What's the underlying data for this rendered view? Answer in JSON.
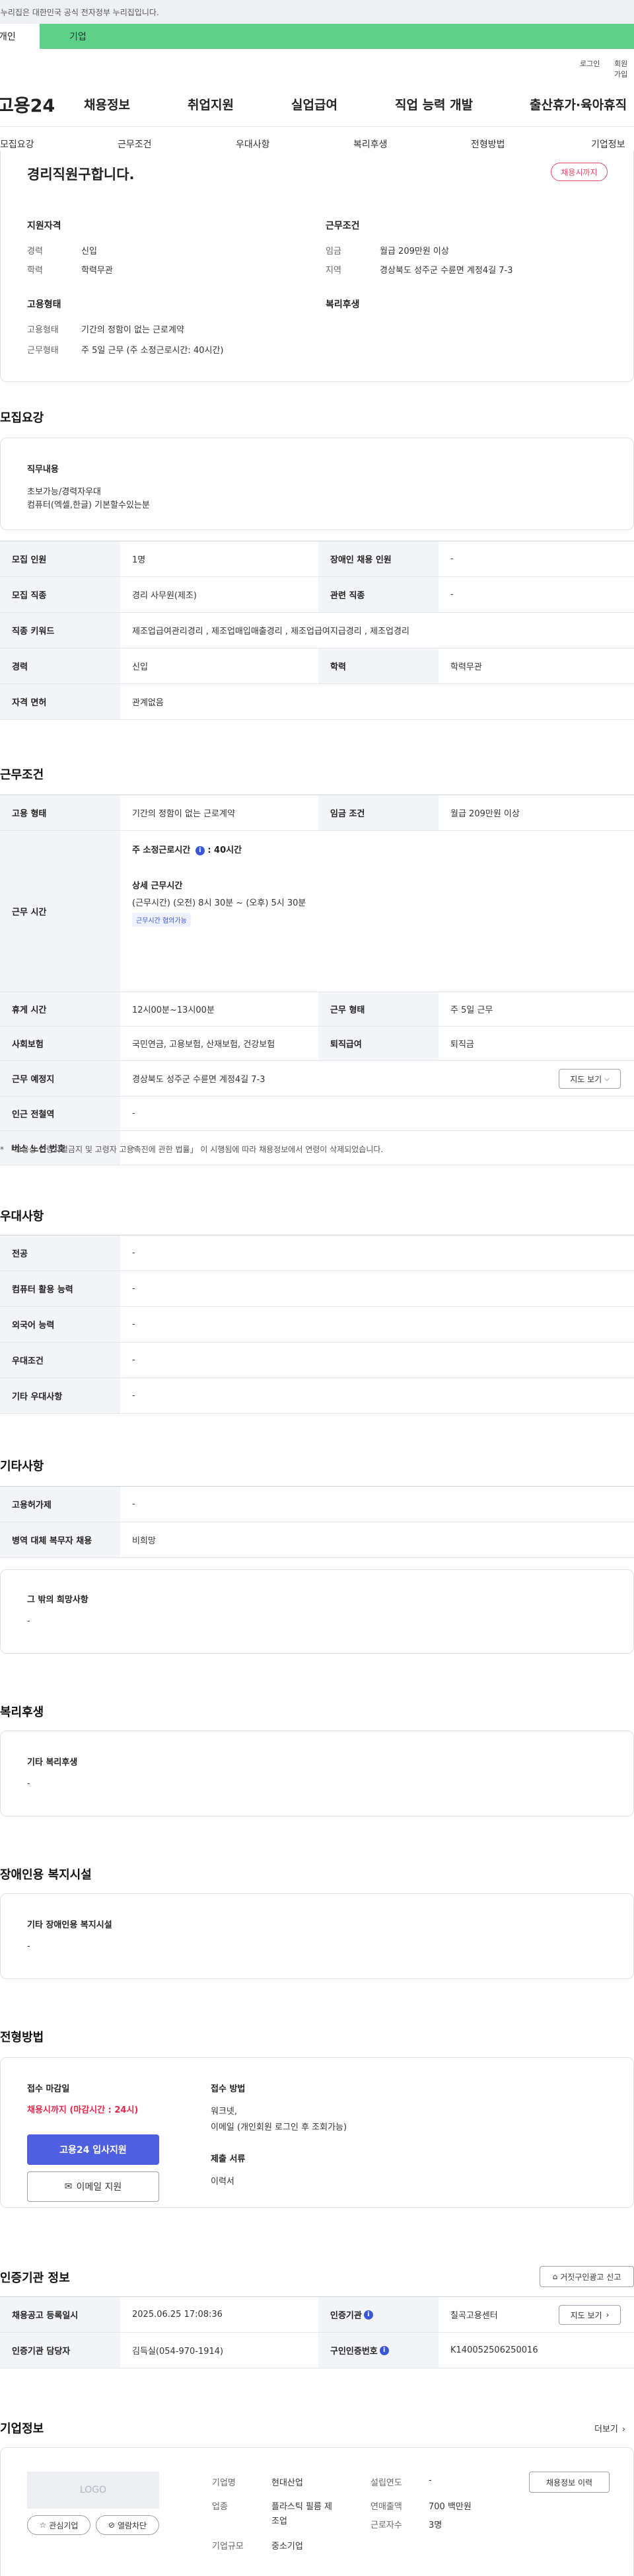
{
  "gov_banner": {
    "text": "이 누리집은 대한민국 공식 전자정부 누리집입니다."
  },
  "user_tabs": {
    "individual": "개인",
    "corporate": "기업"
  },
  "util_links": {
    "login": "로그인",
    "signup": "회원가입"
  },
  "gnb": {
    "logo": "고용24",
    "items": [
      "채용정보",
      "취업지원",
      "실업급여",
      "직업 능력 개발",
      "출산휴가·육아휴직"
    ]
  },
  "subnav": [
    "모집요강",
    "근무조건",
    "우대사항",
    "복리후생",
    "전형방법",
    "기업정보"
  ],
  "summary": {
    "title": "경리직원구합니다.",
    "deadline_badge": "채용시까지",
    "applicant_qual": {
      "heading": "지원자격",
      "career_label": "경력",
      "career": "신입",
      "edu_label": "학력",
      "edu": "학력무관"
    },
    "work_cond": {
      "heading": "근무조건",
      "wage_label": "임금",
      "wage": "월급 209만원 이상",
      "region_label": "지역",
      "region": "경상북도 성주군 수륜면 계정4길 7-3"
    },
    "employment": {
      "heading": "고용형태",
      "type_label": "고용형태",
      "type": "기간의 정함이 없는 근로계약",
      "hours_label": "근무형태",
      "hours": "주 5일 근무 (주 소정근로시간: 40시간)"
    },
    "welfare_heading": "복리후생"
  },
  "recruit": {
    "title": "모집요강",
    "duty_heading": "직무내용",
    "duty_lines": [
      "초보가능/경력자우대",
      "컴퓨터(엑셀,한글) 기본할수있는분"
    ],
    "rows": [
      {
        "h1": "모집 인원",
        "v1": "1명",
        "h2": "장애인 채용 인원",
        "v2": "-"
      },
      {
        "h1": "모집 직종",
        "v1": "경리 사무원(제조)",
        "h2": "관련 직종",
        "v2": "-"
      },
      {
        "h1": "직종 키워드",
        "v1": "제조업급여관리경리 , 제조업매입매출경리 , 제조업급여지급경리 , 제조업경리"
      },
      {
        "h1": "경력",
        "v1": "신입",
        "h2": "학력",
        "v2": "학력무관"
      },
      {
        "h1": "자격 면허",
        "v1": "관계없음"
      }
    ]
  },
  "work": {
    "title": "근무조건",
    "type_h": "고용 형태",
    "type_v": "기간의 정함이 없는 근로계약",
    "wage_h": "임금 조건",
    "wage_v": "월급 209만원 이상",
    "hours_h": "근무 시간",
    "hours_total": "주 소정근로시간",
    "hours_total_val": ": 40시간",
    "hours_detail_h": "상세 근무시간",
    "hours_detail_1": "(근무시간) (오전) 8시 30분 ~ (오후) 5시 30분",
    "hours_tag": "근무시간 협의가능",
    "rest_h": "휴게 시간",
    "rest_v": "12시00분~13시00분",
    "form_h": "근무 형태",
    "form_v": "주 5일 근무",
    "ins_h": "사회보험",
    "ins_v": "국민연금, 고용보험, 산재보험, 건강보험",
    "retire_h": "퇴직급여",
    "retire_v": "퇴직금",
    "loc_h": "근무 예정지",
    "loc_v": "경상북도 성주군 수륜면 계정4길 7-3",
    "map_btn": "지도 보기",
    "subway_h": "인근 전철역",
    "subway_v": "-",
    "bus_h": "버스 노선 번호",
    "bus_v": "-",
    "notice": "「고용상 연령차별금지 및 고령자 고용촉진에 관한 법률」 이 시행됨에 따라 채용정보에서 연령이 삭제되었습니다."
  },
  "pref": {
    "title": "우대사항",
    "rows": [
      {
        "h": "전공",
        "v": "-"
      },
      {
        "h": "컴퓨터 활용 능력",
        "v": "-"
      },
      {
        "h": "외국어 능력",
        "v": "-"
      },
      {
        "h": "우대조건",
        "v": "-"
      },
      {
        "h": "기타 우대사항",
        "v": "-"
      }
    ]
  },
  "etc": {
    "title": "기타사항",
    "rows": [
      {
        "h": "고용허가제",
        "v": "-"
      },
      {
        "h": "병역 대체 복무자 채용",
        "v": "비희망"
      }
    ],
    "other_heading": "그 밖의 희망사항",
    "other_val": "-"
  },
  "welfare": {
    "title": "복리후생",
    "heading": "기타 복리후생",
    "val": "-"
  },
  "disabled": {
    "title": "장애인용 복지시설",
    "heading": "기타 장애인용 복지시설",
    "val": "-"
  },
  "selection": {
    "title": "전형방법",
    "deadline_h": "접수 마감일",
    "deadline_v": "채용시까지 (마감시간 : 24시)",
    "apply_btn": "고용24 입사지원",
    "email_btn": "이메일 지원",
    "method_h": "접수 방법",
    "method_lines": [
      "워크넷,",
      "이메일 (개인회원 로그인 후 조회가능)"
    ],
    "docs_h": "제출 서류",
    "docs_v": "이력서"
  },
  "cert": {
    "title": "인증기관 정보",
    "report_btn": "거짓구인광고 신고",
    "reg_h": "채용공고 등록일시",
    "reg_v": "2025.06.25 17:08:36",
    "org_h": "인증기관",
    "org_v": "칠곡고용센터",
    "detail_btn": "지도 보기",
    "mgr_h": "인증기관 담당자",
    "mgr_v": "김득실(054-970-1914)",
    "num_h": "구인인증번호",
    "num_v": "K140052506250016"
  },
  "company": {
    "title": "기업정보",
    "more": "더보기",
    "logo": "LOGO",
    "fav_btn": "관심기업",
    "block_btn": "열람차단",
    "name_h": "기업명",
    "name_v": "현대산업",
    "ind_h": "업종",
    "ind_v1": "플라스틱 필름 제",
    "ind_v2": "조업",
    "size_h": "기업규모",
    "size_v": "중소기업",
    "year_h": "설립연도",
    "year_v": "-",
    "sales_h": "연매출액",
    "sales_v": "700 백만원",
    "emp_h": "근로자수",
    "emp_v": "3명",
    "history_btn": "채용정보 이력"
  }
}
